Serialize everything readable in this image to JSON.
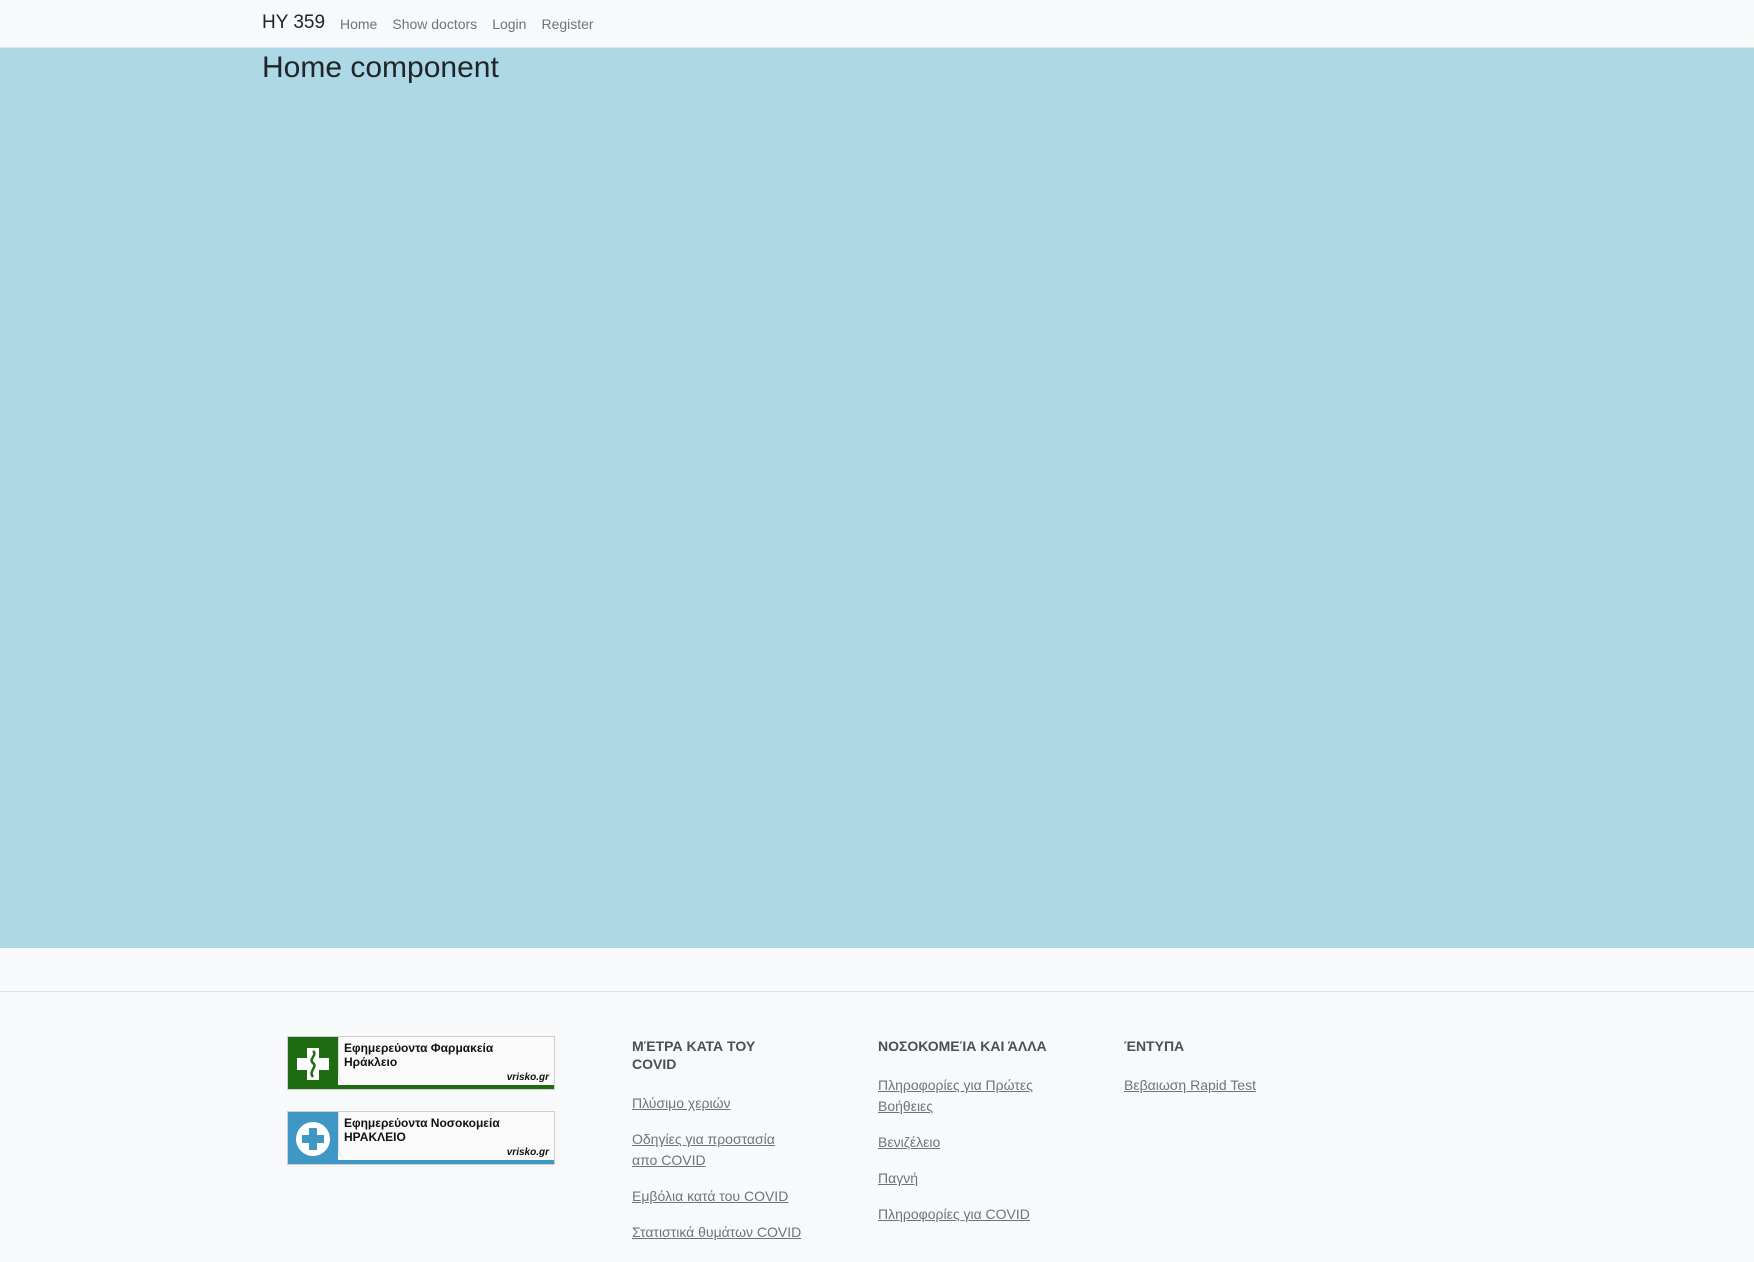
{
  "navbar": {
    "brand": "HY 359",
    "links": [
      "Home",
      "Show doctors",
      "Login",
      "Register"
    ]
  },
  "main": {
    "heading": "Home component",
    "background_color": "#add8e6"
  },
  "footer": {
    "badges": [
      {
        "title": "Εφημερεύοντα Φαρμακεία Ηράκλειο",
        "site": "vrisko.gr",
        "icon": "pharmacy-cross-icon",
        "color": "#1e6b12"
      },
      {
        "title": "Εφημερεύοντα Νοσοκομεία ΗΡΑΚΛΕΙΟ",
        "site": "vrisko.gr",
        "icon": "hospital-plus-icon",
        "color": "#3f97c5"
      }
    ],
    "columns": [
      {
        "heading": "ΜΈΤΡΑ ΚΑΤΑ ΤΟΥ COVID",
        "links": [
          "Πλύσιμο χεριών",
          "Οδηγίες για προστασία απο COVID",
          "Εμβόλια κατά του COVID",
          "Στατιστικά θυμάτων COVID"
        ]
      },
      {
        "heading": "ΝΟΣΟΚΟΜΕΊΑ ΚΑΙ ΆΛΛΑ",
        "links": [
          "Πληροφορίες για Πρώτες Βοήθειες",
          "Βενιζέλειο",
          "Παγνή",
          "Πληροφορίες για COVID"
        ]
      },
      {
        "heading": "ΈΝΤΥΠΑ",
        "links": [
          "Βεβαιωση Rapid Test"
        ]
      }
    ]
  }
}
